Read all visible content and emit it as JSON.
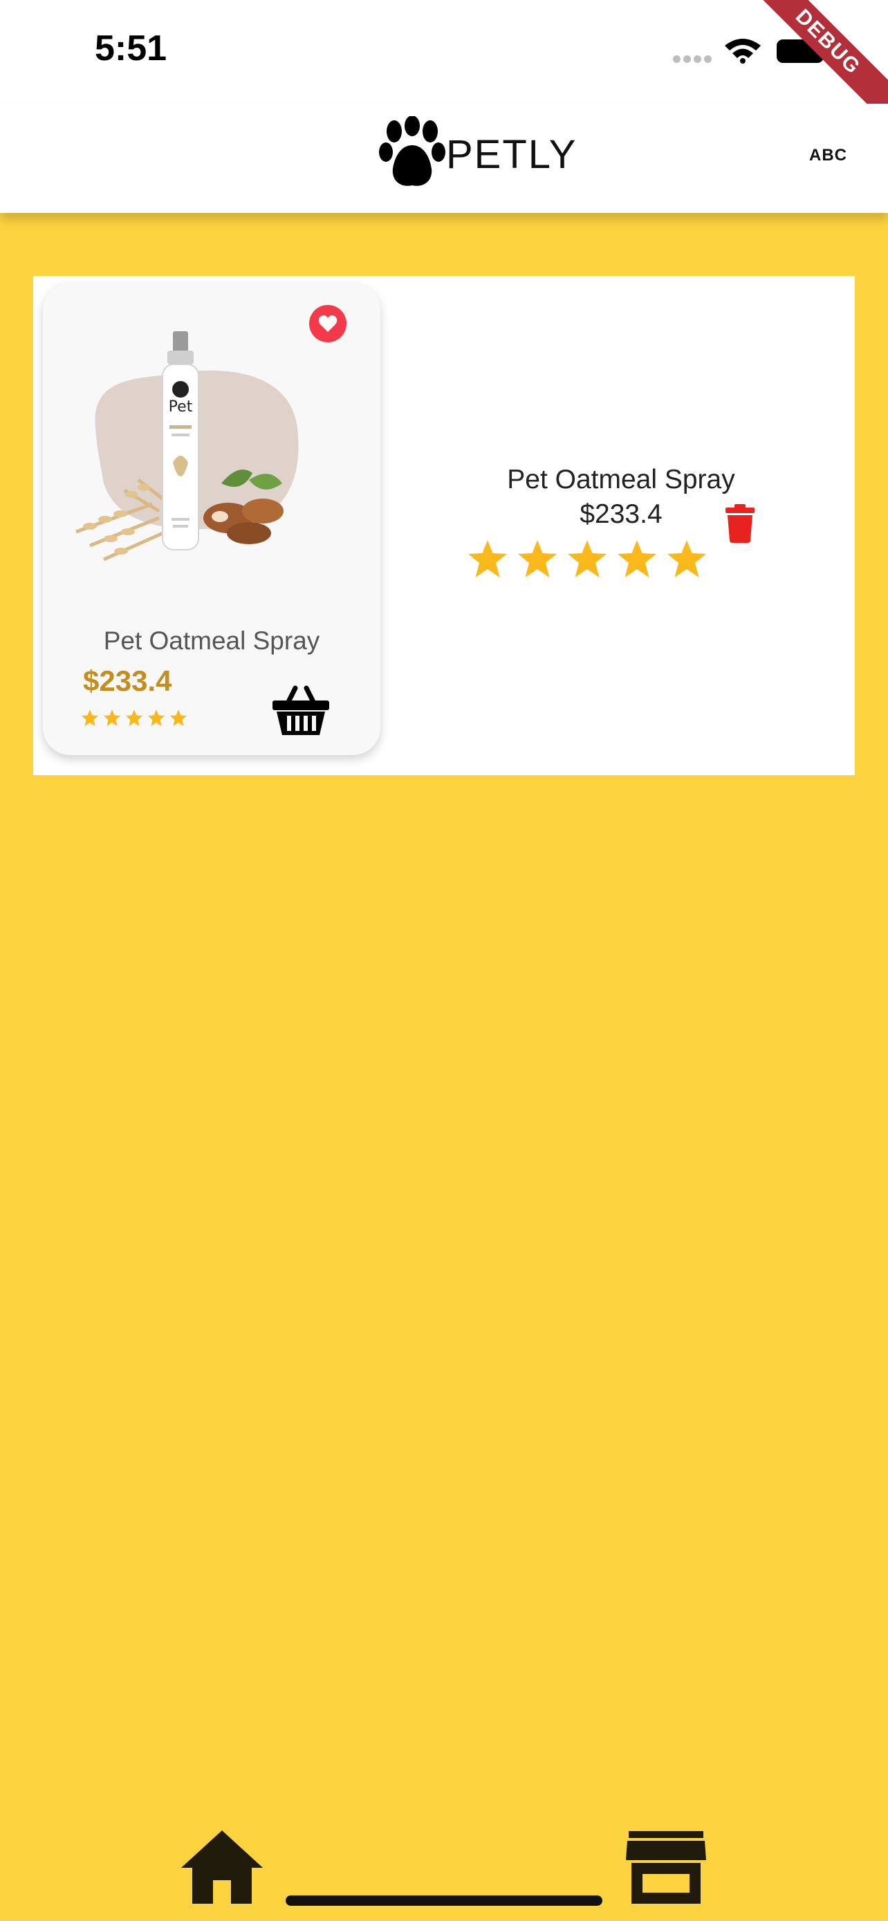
{
  "status_bar": {
    "time": "5:51",
    "debug_label": "DEBUG"
  },
  "app_bar": {
    "title": "PETLY",
    "action_label": "ABC",
    "logo_icon": "paw-icon"
  },
  "cart": {
    "items": [
      {
        "card": {
          "name": "Pet Oatmeal Spray",
          "price": "$233.4",
          "rating": 5,
          "image_brand_text": "Pet",
          "favorite_icon": "heart-icon",
          "cart_icon": "basket-icon"
        },
        "detail": {
          "name": "Pet Oatmeal Spray",
          "price": "$233.4",
          "rating": 5,
          "delete_icon": "trash-icon"
        }
      }
    ]
  },
  "bottom_nav": {
    "items": [
      {
        "icon": "home-icon"
      },
      {
        "icon": "store-icon"
      }
    ]
  },
  "colors": {
    "background": "#FDD43F",
    "price": "#C28E1F",
    "star": "#F9B81B",
    "favorite": "#F23A4A",
    "delete": "#E8231F"
  }
}
